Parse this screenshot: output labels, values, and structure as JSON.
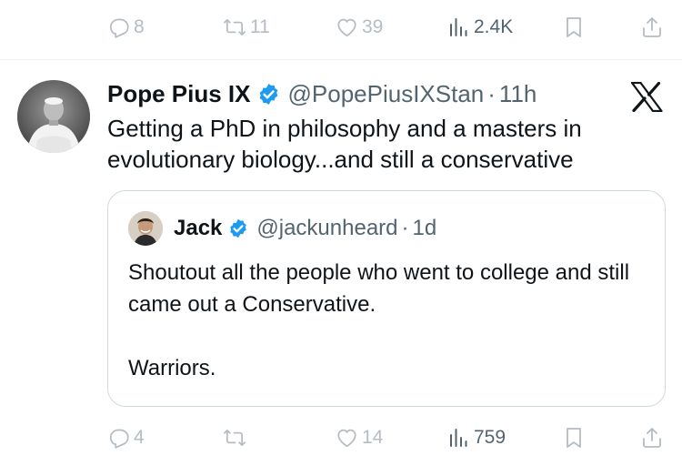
{
  "top_actions": {
    "reply_count": "8",
    "retweet_count": "11",
    "like_count": "39",
    "views_count": "2.4K"
  },
  "tweet": {
    "display_name": "Pope Pius IX",
    "handle": "@PopePiusIXStan",
    "separator": "·",
    "time": "11h",
    "text": "Getting a PhD in philosophy and a masters in evolutionary biology...and still a conservative"
  },
  "quote": {
    "display_name": "Jack",
    "handle": "@jackunheard",
    "separator": "·",
    "time": "1d",
    "line1": "Shoutout all the people who went to college and still came out a Conservative.",
    "line2": "",
    "line3": "Warriors."
  },
  "bottom_actions": {
    "reply_count": "4",
    "retweet_count": "",
    "like_count": "14",
    "views_count": "759"
  },
  "colors": {
    "verified": "#1d9bf0",
    "secondary_text": "#536471",
    "faint_text": "#b4bcc4",
    "border": "#cfd9de"
  },
  "icons": [
    "reply-icon",
    "retweet-icon",
    "like-icon",
    "views-icon",
    "bookmark-icon",
    "share-icon",
    "verified-badge-icon",
    "x-logo-icon"
  ]
}
